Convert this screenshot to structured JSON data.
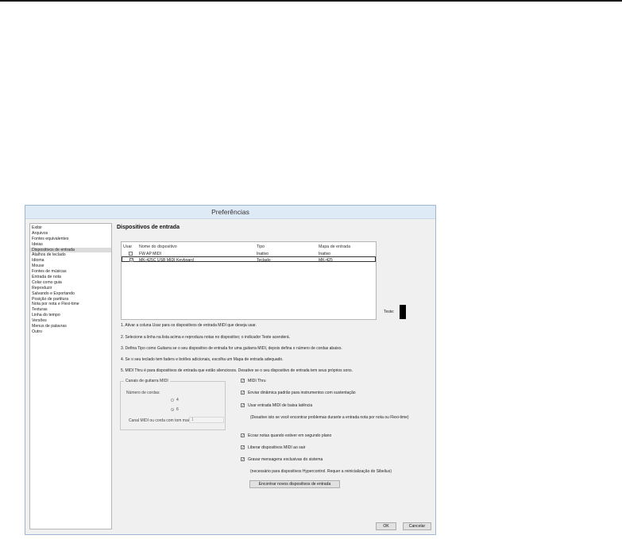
{
  "window": {
    "title": "Preferências"
  },
  "sidebar": {
    "items": [
      "Exibir",
      "Arquivos",
      "Fontes equivalentes",
      "Ideias",
      "Dispositivos de entrada",
      "Atalhos de teclado",
      "Idioma",
      "Mouse",
      "Fontes de músicas",
      "Entrada de nota",
      "Colar como guia",
      "Reproduzir",
      "Salvando e Exportando",
      "Posição de partitura",
      "Nota por nota e Flexi-time",
      "Texturas",
      "Linha do tempo",
      "Versões",
      "Menus de palavras",
      "Outro"
    ],
    "selected": "Dispositivos de entrada"
  },
  "page": {
    "heading": "Dispositivos de entrada"
  },
  "device_table": {
    "headers": {
      "use": "Usar",
      "name": "Nome do dispositivo",
      "type": "Tipo",
      "map": "Mapa de entrada"
    },
    "rows": [
      {
        "checked": false,
        "check_mark": "",
        "name": "FW AP MIDI",
        "type": "Inativo",
        "map": "Inativo"
      },
      {
        "checked": true,
        "check_mark": "✓",
        "name": "MK-425C USB MIDI Keyboard",
        "type": "Teclado",
        "map": "MK-425"
      }
    ]
  },
  "test": {
    "label": "Teste:"
  },
  "instructions": [
    "1. Ativar a coluna Usar para os dispositivos de entrada MIDI que deseja usar.",
    "2. Selecione a linha na lista acima e reproduza notas no dispositivo; o indicador Teste acenderá.",
    "3. Defina Tipo como Guitarra se o seu dispositivo de entrada for uma guitarra MIDI, depois defina o número de cordas abaixo.",
    "4. Se o seu teclado tem faders e botões adicionais, escolha um Mapa de entrada adequado.",
    "5. MIDI Thru é para dispositivos de entrada que estão silenciosos. Desative se o seu dispositivo de entrada tem seus próprios sons."
  ],
  "guitar": {
    "title": "Canais de guitarra MIDI",
    "strings_label": "Número de cordas:",
    "option_4": "4",
    "option_6": "6",
    "selected": "6",
    "channel_label": "Canal MIDI ou corda com tom mais alto",
    "channel_value": "1"
  },
  "options": {
    "midi_thru": "MIDI Thru",
    "send_dynamic": "Enviar dinâmica padrão para instrumentos com sustentação",
    "low_latency": "Usar entrada MIDI de baixa latência",
    "low_latency_note": "(Desative isto se você encontrar problemas durante a entrada nota por nota ou Flexi-time)",
    "echo_background": "Ecoar notas quando estiver em segundo plano",
    "release_devices": "Liberar dispositivos MIDI ao sair",
    "record_sysex": "Gravar mensagens exclusivas do sistema",
    "sysex_note": "(necessário para dispositivos Hypercontrol. Requer a reinicialização do Sibelius)"
  },
  "buttons": {
    "find_devices": "Encontrar novos dispositivos de entrada",
    "ok": "OK",
    "cancel": "Cancelar"
  }
}
